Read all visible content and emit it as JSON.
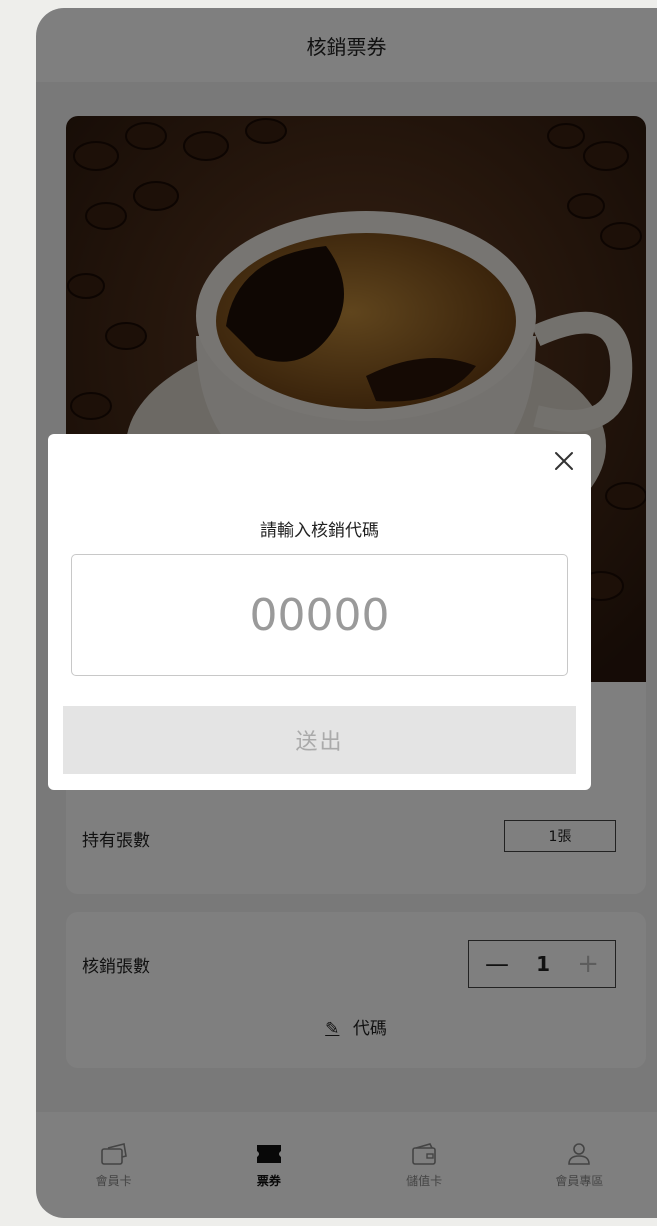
{
  "header": {
    "title": "核銷票券"
  },
  "ticket": {
    "held_label": "持有張數",
    "held_count": "1張",
    "redeem_label": "核銷張數",
    "redeem_qty": "1",
    "code_link_label": "代碼"
  },
  "tabs": [
    {
      "label": "會員卡",
      "icon": "cards-icon"
    },
    {
      "label": "票券",
      "icon": "ticket-icon"
    },
    {
      "label": "儲值卡",
      "icon": "wallet-icon"
    },
    {
      "label": "會員專區",
      "icon": "user-icon"
    }
  ],
  "active_tab": "票券",
  "modal": {
    "title": "請輸入核銷代碼",
    "input_value": "",
    "input_placeholder": "00000",
    "submit_label": "送出"
  },
  "colors": {
    "overlay": "#000000",
    "coffee": "#2a1a10",
    "button_disabled": "#e4e4e4"
  }
}
